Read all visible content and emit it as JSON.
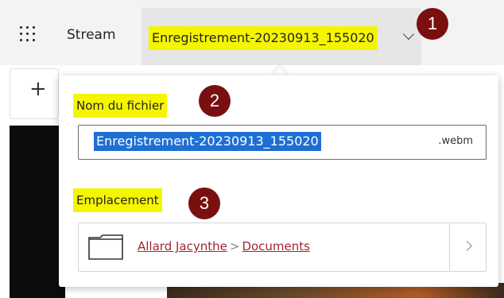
{
  "header": {
    "app_name": "Stream",
    "file_title": "Enregistrement-20230913_155020"
  },
  "toolbar": {
    "add_symbol": "+"
  },
  "dialog": {
    "filename_label": "Nom du fichier",
    "filename_value": "Enregistrement-20230913_155020",
    "file_extension": ".webm",
    "location_label": "Emplacement",
    "location_path": {
      "owner": "Allard Jacynthe",
      "separator": ">",
      "folder": "Documents"
    }
  },
  "annotations": [
    "1",
    "2",
    "3"
  ],
  "colors": {
    "highlight": "#f5f500",
    "badge": "#7a0f0f",
    "selection": "#1e6fd3",
    "link": "#a4262c"
  }
}
